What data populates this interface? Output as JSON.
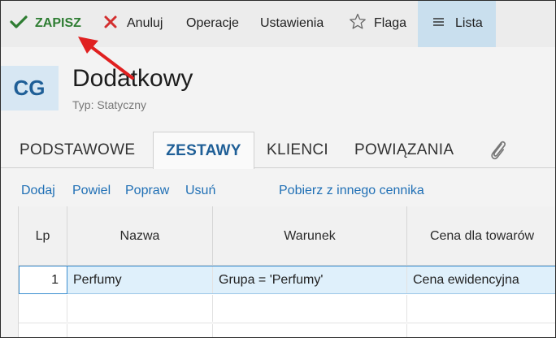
{
  "toolbar": {
    "save_label": "ZAPISZ",
    "cancel_label": "Anuluj",
    "operations_label": "Operacje",
    "settings_label": "Ustawienia",
    "flag_label": "Flaga",
    "list_label": "Lista"
  },
  "header": {
    "avatar_initials": "CG",
    "title": "Dodatkowy",
    "subtitle": "Typ: Statyczny"
  },
  "tabs": [
    {
      "label": "PODSTAWOWE",
      "active": false
    },
    {
      "label": "ZESTAWY",
      "active": true
    },
    {
      "label": "KLIENCI",
      "active": false
    },
    {
      "label": "POWIĄZANIA",
      "active": false
    }
  ],
  "actions": {
    "add": "Dodaj",
    "duplicate": "Powiel",
    "edit": "Popraw",
    "delete": "Usuń",
    "fetch": "Pobierz z innego cennika"
  },
  "grid": {
    "columns": [
      "Lp",
      "Nazwa",
      "Warunek",
      "Cena dla towarów"
    ],
    "rows": [
      {
        "lp": "1",
        "name": "Perfumy",
        "condition": "Grupa = 'Perfumy'",
        "price": "Cena ewidencyjna"
      }
    ]
  },
  "colors": {
    "save": "#2e7d32",
    "cancel": "#d32f2f",
    "accent": "#1f5f97",
    "link": "#1f6fb5",
    "list_active_bg": "#c9dfee",
    "annotation_arrow": "#e02020"
  },
  "icons": {
    "save": "check-icon",
    "cancel": "x-icon",
    "flag": "star-outline-icon",
    "list": "hamburger-icon",
    "attachment": "paperclip-icon"
  }
}
